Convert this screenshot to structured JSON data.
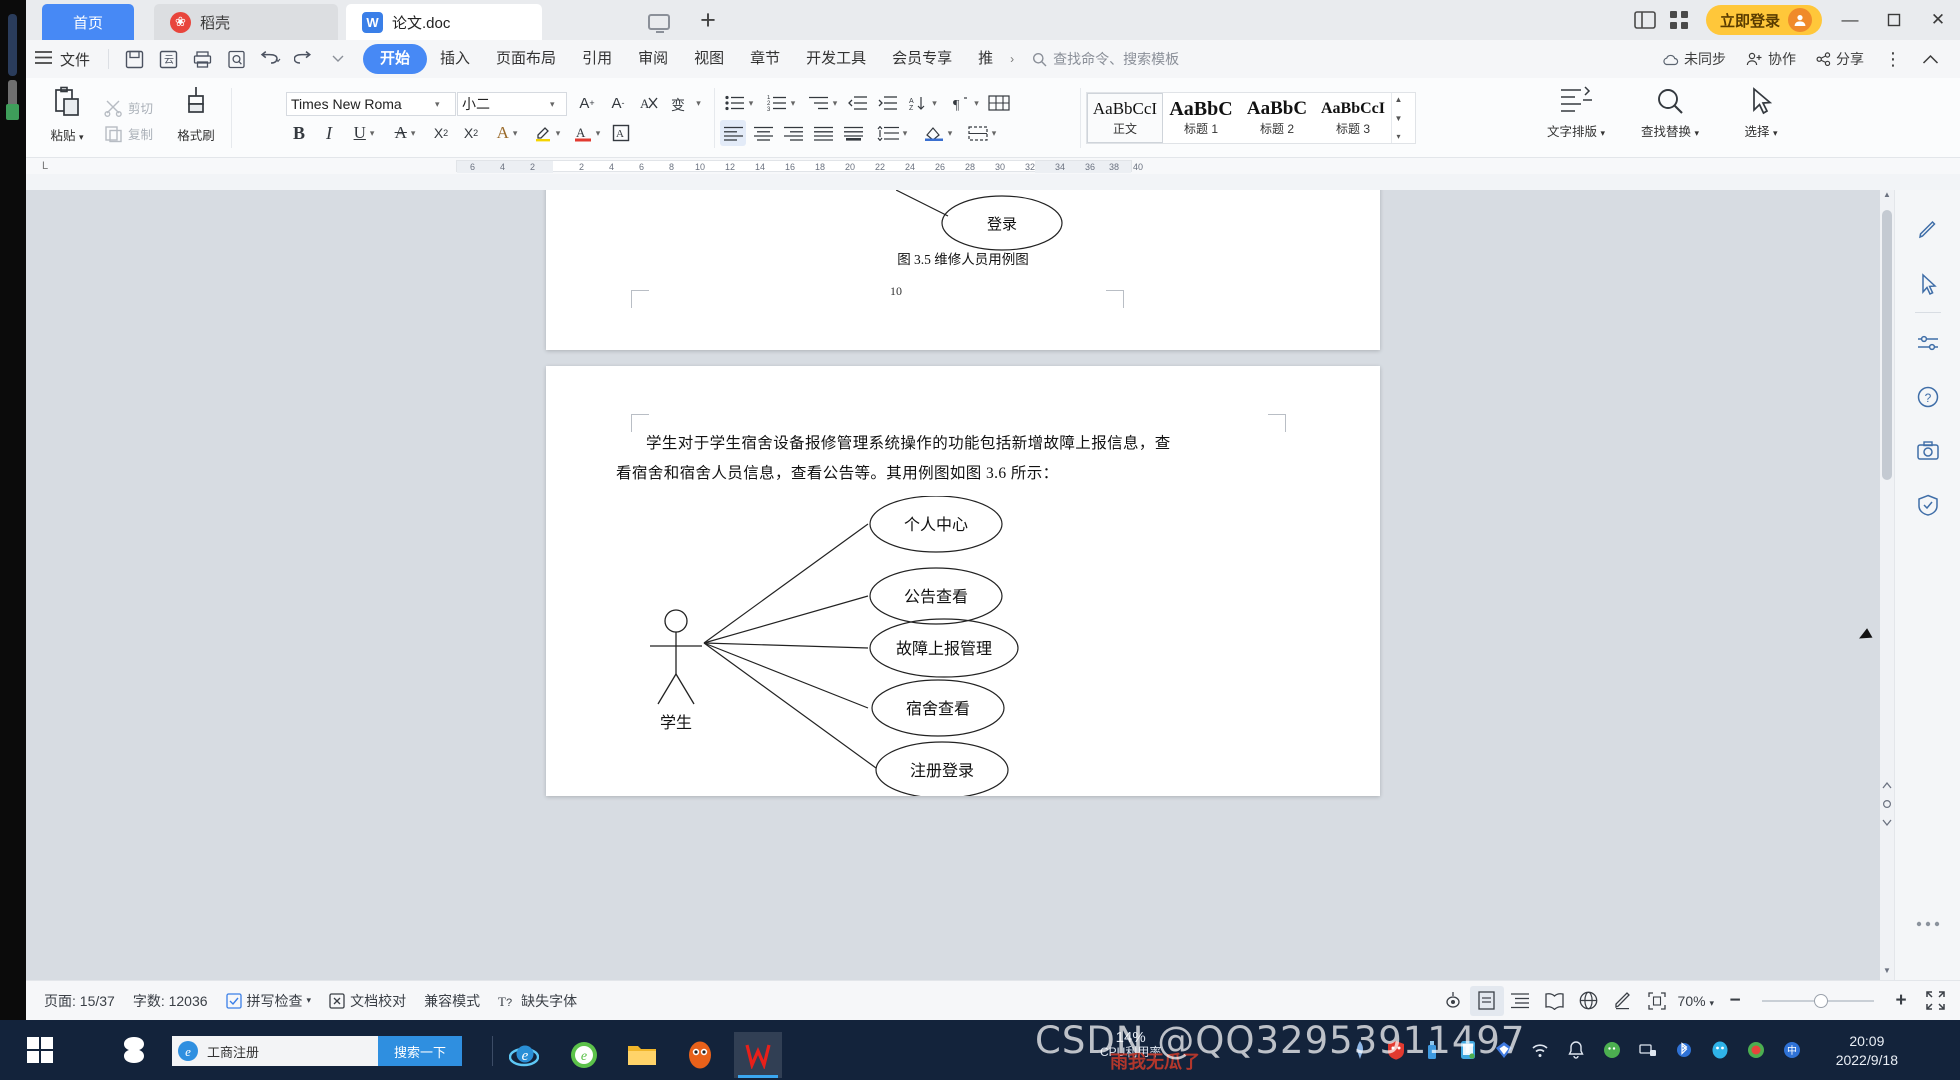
{
  "window": {
    "tabs": [
      {
        "label": "首页",
        "icon": "home-icon",
        "active": false
      },
      {
        "label": "稻壳",
        "icon": "daoke-icon",
        "active": false
      },
      {
        "label": "论文.doc",
        "icon": "wps-doc-icon",
        "active": true
      }
    ],
    "new_tab_label": "+",
    "login_label": "立即登录",
    "controls": {
      "minimize": "—",
      "maximize": "▢",
      "close": "✕"
    }
  },
  "menu": {
    "file_label": "文件",
    "quick_icons": [
      "save-icon",
      "save-as-icon",
      "print-icon",
      "print-preview-icon",
      "undo-icon",
      "redo-icon",
      "customize-icon"
    ],
    "tabs": [
      {
        "label": "开始",
        "active": true
      },
      {
        "label": "插入",
        "active": false
      },
      {
        "label": "页面布局",
        "active": false
      },
      {
        "label": "引用",
        "active": false
      },
      {
        "label": "审阅",
        "active": false
      },
      {
        "label": "视图",
        "active": false
      },
      {
        "label": "章节",
        "active": false
      },
      {
        "label": "开发工具",
        "active": false
      },
      {
        "label": "会员专享",
        "active": false
      },
      {
        "label": "推",
        "active": false
      }
    ],
    "more_chevron": "›",
    "search_placeholder": "查找命令、搜索模板",
    "right_items": [
      {
        "label": "未同步",
        "icon": "cloud-sync-icon"
      },
      {
        "label": "协作",
        "icon": "collaborate-icon"
      },
      {
        "label": "分享",
        "icon": "share-icon"
      }
    ],
    "overflow": "⋮",
    "collapse": "︿"
  },
  "ribbon": {
    "clipboard": {
      "paste_label": "粘贴",
      "cut_label": "剪切",
      "copy_label": "复制",
      "format_painter_label": "格式刷"
    },
    "font": {
      "family_value": "Times New Roma",
      "size_value": "小二",
      "grow_label": "A⁺",
      "shrink_label": "A⁻",
      "clear_format": "clear-format-icon",
      "pinyin_guide": "pinyin-icon",
      "bold": "B",
      "italic": "I",
      "underline": "U",
      "strikethrough": "A",
      "superscript": "X²",
      "subscript": "X₂",
      "text_effects": "A",
      "highlight": "highlight-icon",
      "font_color": "font-color-icon",
      "char_box": "char-border-icon"
    },
    "paragraph": {
      "bullets": "bullet-list-icon",
      "numbering": "numbered-list-icon",
      "multilevel": "multilevel-list-icon",
      "dec_indent": "decrease-indent-icon",
      "inc_indent": "increase-indent-icon",
      "sort": "sort-icon",
      "show_marks": "show-marks-icon",
      "align_left": "align-left-icon",
      "align_center": "align-center-icon",
      "align_right": "align-right-icon",
      "justify": "justify-icon",
      "distribute": "distribute-icon",
      "line_spacing": "line-spacing-icon",
      "shading": "shading-icon",
      "borders": "borders-icon"
    },
    "styles": [
      {
        "preview": "AaBbCcI",
        "name": "正文",
        "selected": true
      },
      {
        "preview": "AaBbC",
        "name": "标题 1",
        "selected": false
      },
      {
        "preview": "AaBbC",
        "name": "标题 2",
        "selected": false
      },
      {
        "preview": "AaBbCcI",
        "name": "标题 3",
        "selected": false
      }
    ],
    "typeset_label": "文字排版",
    "find_replace_label": "查找替换",
    "select_label": "选择"
  },
  "ruler": {
    "corner": "L",
    "ticks": [
      "6",
      "4",
      "2",
      "2",
      "4",
      "6",
      "8",
      "10",
      "12",
      "14",
      "16",
      "18",
      "20",
      "22",
      "24",
      "26",
      "28",
      "30",
      "32",
      "34",
      "36",
      "38",
      "40"
    ]
  },
  "document": {
    "page1": {
      "ellipse_login": "登录",
      "figure_caption": "图 3.5  维修人员用例图",
      "page_number": "10"
    },
    "page2": {
      "paragraph_line1": "学生对于学生宿舍设备报修管理系统操作的功能包括新增故障上报信息，查",
      "paragraph_line2": "看宿舍和宿舍人员信息，查看公告等。其用例图如图 3.6 所示：",
      "actor_label": "学生",
      "use_cases": [
        "个人中心",
        "公告查看",
        "故障上报管理",
        "宿舍查看",
        "注册登录"
      ]
    }
  },
  "right_panel": {
    "buttons": [
      "pen-edit-icon",
      "cursor-select-icon",
      "minus-lines-icon",
      "help-icon",
      "screenshot-icon",
      "shield-icon",
      "more-dots-icon"
    ]
  },
  "status_bar": {
    "page_label": "页面: 15/37",
    "word_count_label": "字数: 12036",
    "spellcheck_label": "拼写检查",
    "proofread_label": "文档校对",
    "compat_label": "兼容模式",
    "missing_font_label": "缺失字体",
    "view_icons": [
      "eye-icon",
      "page-view-icon",
      "outline-view-icon",
      "read-view-icon",
      "web-view-icon",
      "write-view-icon"
    ],
    "fit_icon": "fit-page-icon",
    "zoom_value": "70%",
    "zoom_minus": "−",
    "zoom_plus": "+",
    "fullscreen_icon": "fullscreen-icon"
  },
  "taskbar": {
    "start_icon": "windows-start-icon",
    "sogou_icon": "sogou-icon",
    "search_query": "工商注册",
    "search_button": "搜索一下",
    "apps": [
      "ie-browser-icon",
      "360-browser-icon",
      "file-explorer-icon",
      "qq-browser-icon",
      "wps-icon"
    ],
    "tray_icons": [
      "pen-icon",
      "shield-red-icon",
      "usb-icon",
      "phone-icon",
      "diamond-icon",
      "wifi-icon",
      "bell-icon",
      "wechat-icon",
      "network-icon",
      "bluetooth-icon",
      "qq-icon",
      "input-method-icon",
      "ime-icon"
    ],
    "cpu_percent": "14%",
    "cpu_label": "CPU利用率",
    "overlay_text": "雨我无瓜了",
    "clock_time": "20:09",
    "clock_date": "2022/9/18"
  },
  "watermark": {
    "line1": "CSDN @QQ32953911497",
    "line2": ""
  },
  "colors": {
    "accent": "#4789f5",
    "tab_active": "#ffffff",
    "login_yellow": "#ffc73a",
    "taskbar": "#13233b",
    "canvas_gray": "#d7dce2"
  }
}
